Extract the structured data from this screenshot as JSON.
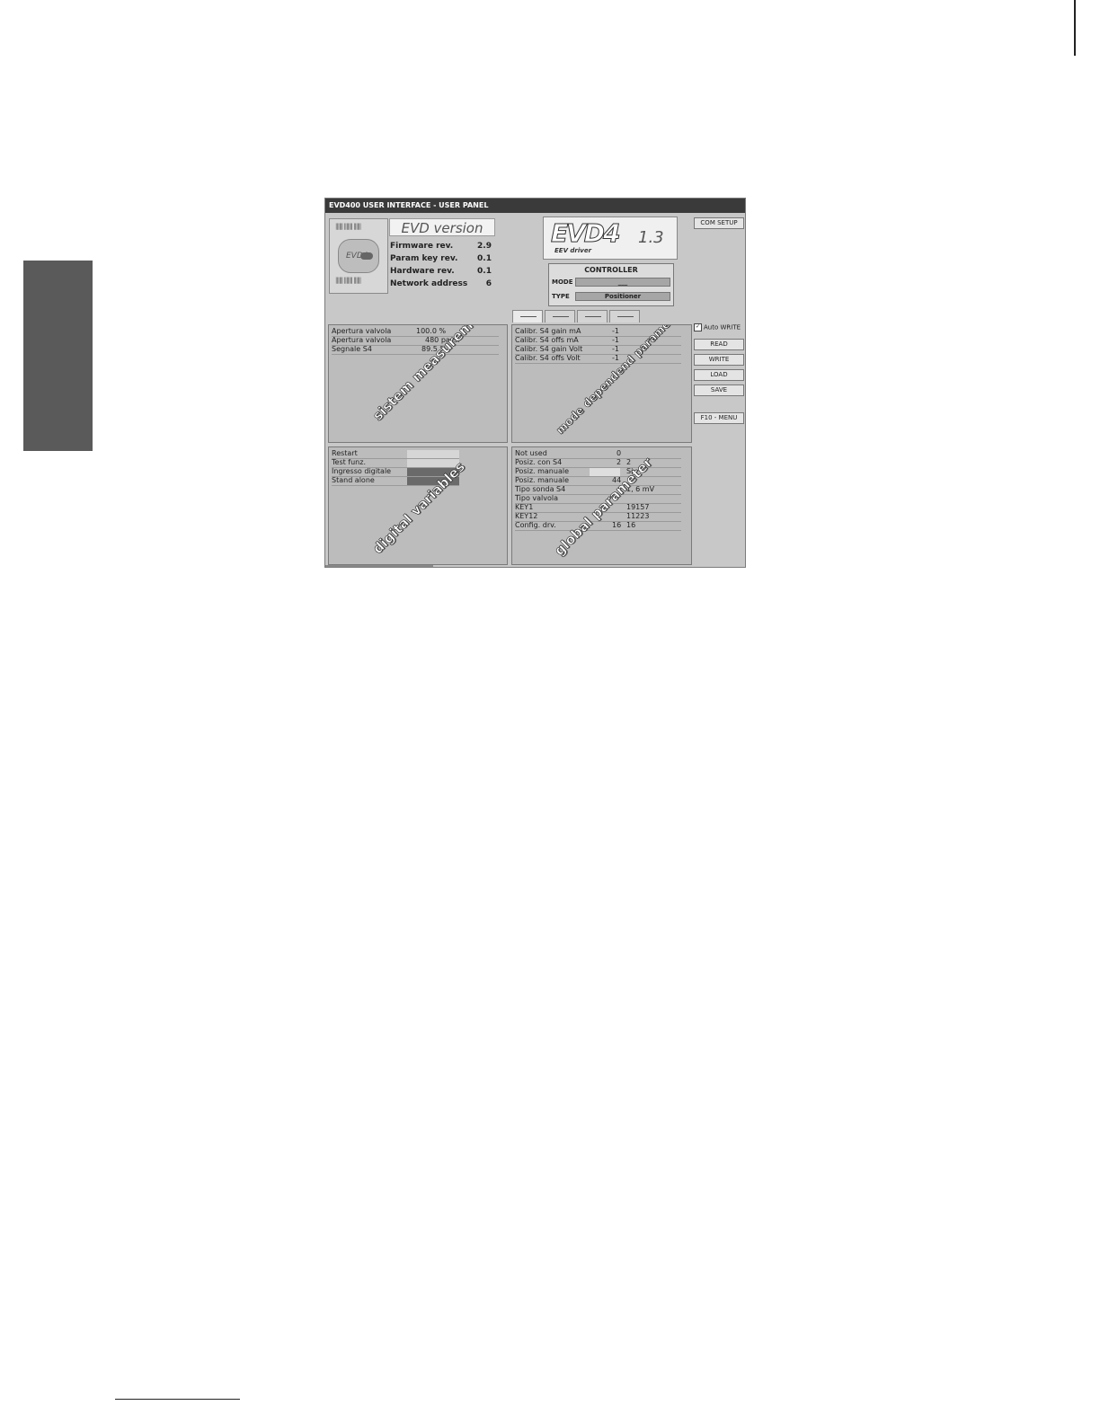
{
  "window": {
    "title": "EVD400 USER INTERFACE - USER PANEL"
  },
  "version": {
    "title": "EVD version",
    "device_logo": "EVD4",
    "rows": [
      {
        "label": "Firmware rev.",
        "value": "2.9"
      },
      {
        "label": "Param key rev.",
        "value": "0.1"
      },
      {
        "label": "Hardware rev.",
        "value": "0.1"
      },
      {
        "label": "Network address",
        "value": "6"
      }
    ]
  },
  "logo": {
    "text": "EVD4",
    "subtitle": "EEV driver",
    "version": "1.3"
  },
  "controller": {
    "title": "CONTROLLER",
    "mode_label": "MODE",
    "mode_value": "___",
    "type_label": "TYPE",
    "type_value": "Positioner"
  },
  "buttons": {
    "com_setup": "COM SETUP",
    "auto_write": "Auto WRITE",
    "read": "READ",
    "write": "WRITE",
    "load": "LOAD",
    "save": "SAVE",
    "menu": "F10 - MENU"
  },
  "system_measurement": {
    "overlay": "sistem measurement",
    "rows": [
      {
        "name": "Apertura valvola",
        "value": "100.0 %"
      },
      {
        "name": "Apertura valvola",
        "value": "480 passi"
      },
      {
        "name": "Segnale S4",
        "value": "89.5 %"
      }
    ]
  },
  "mode_dependent": {
    "overlay": "mode dependend parameter",
    "rows": [
      {
        "name": "Calibr. S4 gain mA",
        "value": "-1"
      },
      {
        "name": "Calibr. S4 offs mA",
        "value": "-1"
      },
      {
        "name": "Calibr. S4 gain Volt",
        "value": "-1"
      },
      {
        "name": "Calibr. S4 offs Volt",
        "value": "-1"
      }
    ]
  },
  "digital_variables": {
    "overlay": "digital variables",
    "rows": [
      {
        "name": "Restart",
        "color": "#d6d6d6"
      },
      {
        "name": "Test funz.",
        "color": "#d6d6d6"
      },
      {
        "name": "Ingresso digitale",
        "color": "#6a6a6a"
      },
      {
        "name": "Stand alone",
        "color": "#6a6a6a"
      }
    ]
  },
  "global_parameter": {
    "overlay": "global parameter",
    "rows": [
      {
        "name": "Not used",
        "v1": "0",
        "v2": ""
      },
      {
        "name": "Posiz. con S4",
        "v1": "2",
        "v2": "2"
      },
      {
        "name": "Posiz. manuale",
        "v1": "",
        "v2": "Si"
      },
      {
        "name": "Posiz. manuale",
        "v1": "44",
        "v2": ""
      },
      {
        "name": "Tipo sonda S4",
        "v1": "",
        "v2": "1, 6 mV"
      },
      {
        "name": "Tipo valvola",
        "v1": "",
        "v2": ""
      },
      {
        "name": "KEY1",
        "v1": "",
        "v2": "19157"
      },
      {
        "name": "KEY12",
        "v1": "",
        "v2": "11223"
      },
      {
        "name": "Config. drv.",
        "v1": "16",
        "v2": "16"
      }
    ]
  }
}
